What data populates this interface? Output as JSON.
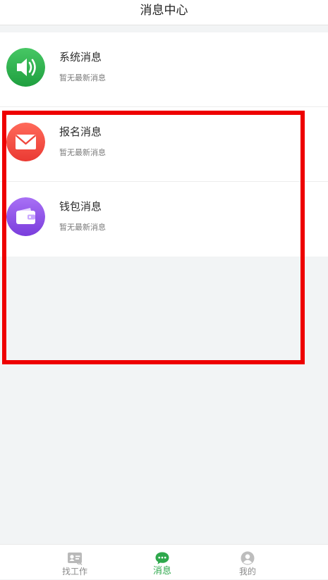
{
  "header": {
    "title": "消息中心"
  },
  "messages": [
    {
      "title": "系统消息",
      "subtitle": "暂无最新消息",
      "icon": "speaker-icon",
      "color": "#2fb34f"
    },
    {
      "title": "报名消息",
      "subtitle": "暂无最新消息",
      "icon": "envelope-icon",
      "color": "#f0483e"
    },
    {
      "title": "钱包消息",
      "subtitle": "暂无最新消息",
      "icon": "wallet-icon",
      "color": "#8d52e8"
    }
  ],
  "tabs": [
    {
      "label": "找工作",
      "icon": "job-card-icon",
      "active": false
    },
    {
      "label": "消息",
      "icon": "chat-bubble-icon",
      "active": true
    },
    {
      "label": "我的",
      "icon": "profile-icon",
      "active": false
    }
  ],
  "colors": {
    "active_tab": "#2ea84c",
    "inactive_tab": "#8a8a8a",
    "highlight": "#ee0000"
  }
}
